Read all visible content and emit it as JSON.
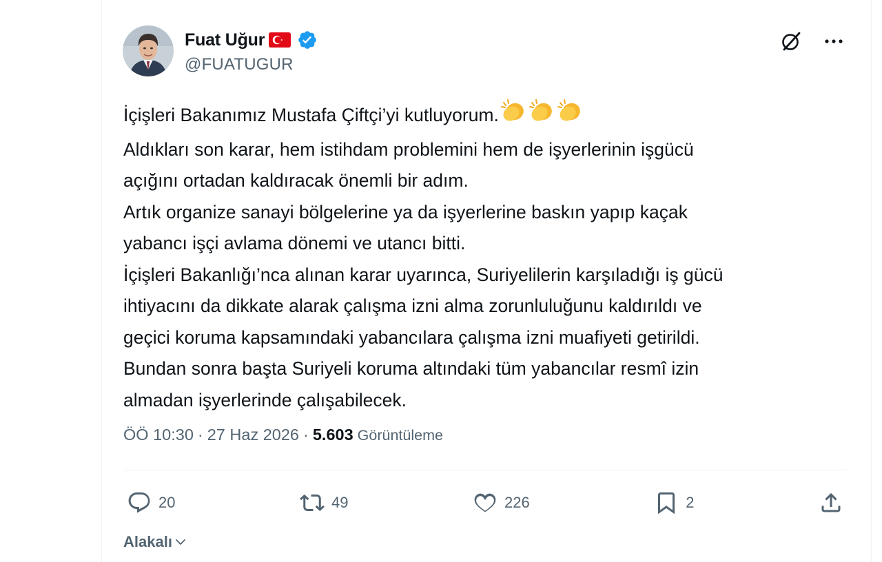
{
  "author": {
    "name": "Fuat Uğur",
    "handle": "@FUATUGUR"
  },
  "tweet": {
    "first_line": "İçişleri Bakanımız Mustafa Çiftçi’yi kutluyorum.",
    "body": "Aldıkları son karar, hem istihdam problemini hem de işyerlerinin işgücü\naçığını ortadan kaldıracak önemli bir adım.\nArtık organize sanayi bölgelerine ya da işyerlerine baskın yapıp kaçak\nyabancı işçi avlama dönemi ve utancı bitti.\nİçişleri Bakanlığı’nca alınan karar uyarınca, Suriyelilerin karşıladığı iş gücü\nihtiyacını da dikkate alarak çalışma izni alma zorunluluğunu kaldırıldı ve\ngeçici koruma kapsamındaki yabancılara çalışma izni muafiyeti getirildi.\nBundan sonra başta Suriyeli koruma altındaki tüm yabancılar resmî izin\nalmadan işyerlerinde çalışabilecek."
  },
  "meta": {
    "time": "ÖÖ 10:30",
    "separator": "·",
    "date": "27 Haz 2026",
    "views": "5.603",
    "views_label": "Görüntüleme"
  },
  "actions": {
    "replies": "20",
    "retweets": "49",
    "likes": "226",
    "bookmarks": "2"
  },
  "related_label": "Alakalı",
  "colors": {
    "text": "#0f1419",
    "secondary": "#536471",
    "verified": "#1d9bf0",
    "divider": "#eff3f4"
  },
  "icons": [
    "grok-icon",
    "more-icon",
    "reply-icon",
    "retweet-icon",
    "like-icon",
    "bookmark-icon",
    "share-icon",
    "chevron-down-icon",
    "verified-badge-icon",
    "turkey-flag-icon",
    "clapping-hands-icon"
  ]
}
